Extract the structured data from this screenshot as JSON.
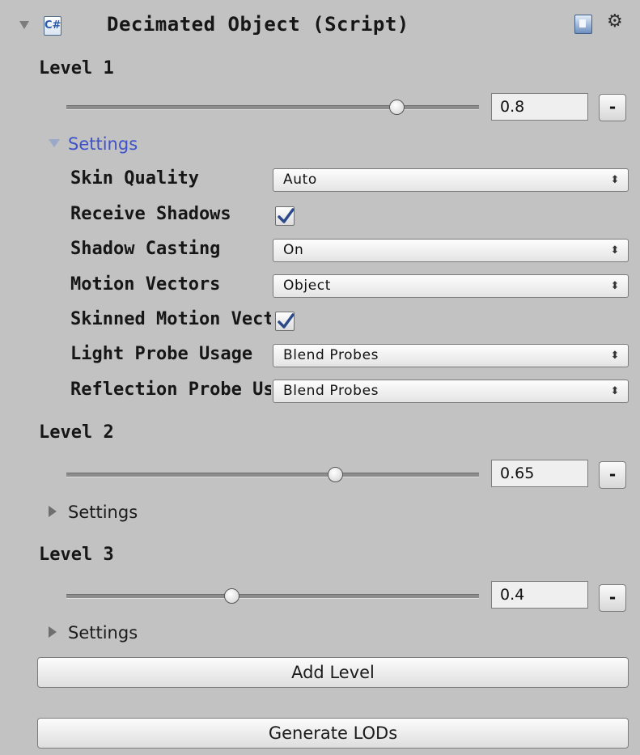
{
  "component": {
    "title": "Decimated Object (Script)",
    "script_icon_glyph": "C#"
  },
  "levels": [
    {
      "label": "Level 1",
      "value": 0.8,
      "value_text": "0.8",
      "remove_label": "-",
      "settings_label": "Settings",
      "settings_expanded": true
    },
    {
      "label": "Level 2",
      "value": 0.65,
      "value_text": "0.65",
      "remove_label": "-",
      "settings_label": "Settings",
      "settings_expanded": false
    },
    {
      "label": "Level 3",
      "value": 0.4,
      "value_text": "0.4",
      "remove_label": "-",
      "settings_label": "Settings",
      "settings_expanded": false
    }
  ],
  "settings": {
    "skin_quality": {
      "label": "Skin Quality",
      "value": "Auto"
    },
    "receive_shadows": {
      "label": "Receive Shadows",
      "checked": true
    },
    "shadow_casting": {
      "label": "Shadow Casting",
      "value": "On"
    },
    "motion_vectors": {
      "label": "Motion Vectors",
      "value": "Object"
    },
    "skinned_motion": {
      "label": "Skinned Motion Vectors",
      "checked": true
    },
    "light_probe_usage": {
      "label": "Light Probe Usage",
      "value": "Blend Probes"
    },
    "reflection_probe_usage": {
      "label": "Reflection Probe Usage",
      "value": "Blend Probes"
    }
  },
  "buttons": {
    "add_level": "Add Level",
    "generate_lods": "Generate LODs"
  },
  "colors": {
    "background": "#c2c2c2",
    "settings_link": "#3e53c9",
    "checkmark": "#2c4a8a"
  }
}
